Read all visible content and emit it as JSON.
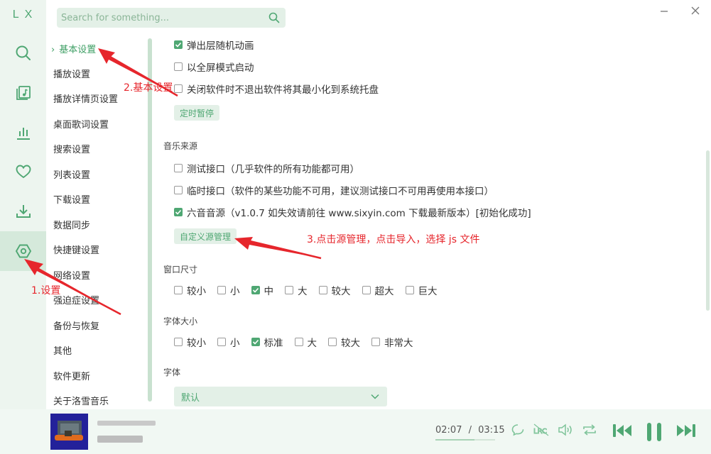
{
  "app": {
    "logo": "LX",
    "colors": {
      "accent": "#4fa773",
      "accent_light": "#e3f0e7",
      "annotation": "#e6262c"
    }
  },
  "rail": {
    "items": [
      {
        "icon": "search-icon"
      },
      {
        "icon": "music-list-icon"
      },
      {
        "icon": "chart-bars-icon"
      },
      {
        "icon": "heart-icon"
      },
      {
        "icon": "download-icon"
      },
      {
        "icon": "settings-hexagon-icon",
        "active": true
      }
    ]
  },
  "search": {
    "placeholder": "Search for something..."
  },
  "nav": {
    "items": [
      {
        "label": "基本设置",
        "active": true,
        "chevron": "›"
      },
      {
        "label": "播放设置"
      },
      {
        "label": "播放详情页设置"
      },
      {
        "label": "桌面歌词设置"
      },
      {
        "label": "搜索设置"
      },
      {
        "label": "列表设置"
      },
      {
        "label": "下载设置"
      },
      {
        "label": "数据同步"
      },
      {
        "label": "快捷键设置"
      },
      {
        "label": "网络设置"
      },
      {
        "label": "强迫症设置"
      },
      {
        "label": "备份与恢复"
      },
      {
        "label": "其他"
      },
      {
        "label": "软件更新"
      },
      {
        "label": "关于洛雪音乐"
      }
    ]
  },
  "content": {
    "basic": {
      "options": [
        {
          "label": "弹出层随机动画",
          "checked": true
        },
        {
          "label": "以全屏模式启动",
          "checked": false
        },
        {
          "label": "关闭软件时不退出软件将其最小化到系统托盘",
          "checked": false
        }
      ],
      "timer_button": "定时暂停"
    },
    "music_source": {
      "title": "音乐来源",
      "options": [
        {
          "label": "测试接口（几乎软件的所有功能都可用）",
          "checked": false
        },
        {
          "label": "临时接口（软件的某些功能不可用，建议测试接口不可用再使用本接口）",
          "checked": false
        },
        {
          "label": "六音音源（v1.0.7 如失效请前往 www.sixyin.com 下载最新版本）[初始化成功]",
          "checked": true
        }
      ],
      "custom_button": "自定义源管理"
    },
    "window_size": {
      "title": "窗口尺寸",
      "options": [
        {
          "label": "较小",
          "checked": false
        },
        {
          "label": "小",
          "checked": false
        },
        {
          "label": "中",
          "checked": true
        },
        {
          "label": "大",
          "checked": false
        },
        {
          "label": "较大",
          "checked": false
        },
        {
          "label": "超大",
          "checked": false
        },
        {
          "label": "巨大",
          "checked": false
        }
      ]
    },
    "font_size": {
      "title": "字体大小",
      "options": [
        {
          "label": "较小",
          "checked": false
        },
        {
          "label": "小",
          "checked": false
        },
        {
          "label": "标准",
          "checked": true
        },
        {
          "label": "大",
          "checked": false
        },
        {
          "label": "较大",
          "checked": false
        },
        {
          "label": "非常大",
          "checked": false
        }
      ]
    },
    "font": {
      "title": "字体",
      "selected": "默认"
    }
  },
  "player": {
    "current_time": "02:07",
    "separator": "/",
    "total_time": "03:15",
    "progress": 0.65
  },
  "annotations": [
    {
      "text": "1.设置"
    },
    {
      "text": "2.基本设置"
    },
    {
      "text": "3.点击源管理，点击导入，选择 js 文件"
    }
  ]
}
